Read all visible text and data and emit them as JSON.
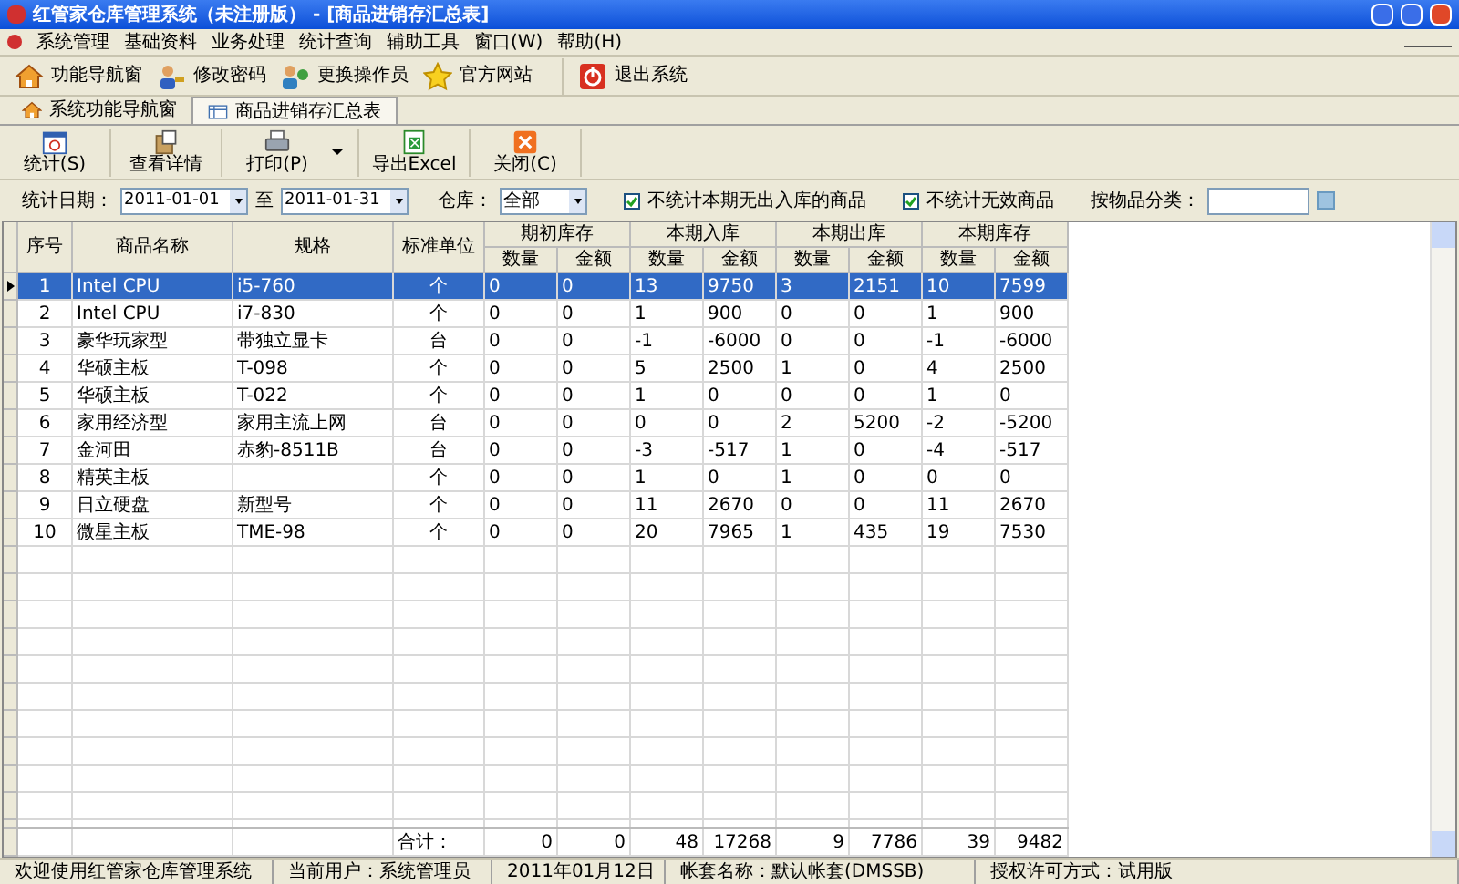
{
  "window": {
    "title": "红管家仓库管理系统（未注册版） - [商品进销存汇总表]"
  },
  "menu": [
    "系统管理",
    "基础资料",
    "业务处理",
    "统计查询",
    "辅助工具",
    "窗口(W)",
    "帮助(H)"
  ],
  "main_toolbar": [
    "功能导航窗",
    "修改密码",
    "更换操作员",
    "官方网站",
    "退出系统"
  ],
  "tabs": [
    {
      "label": "系统功能导航窗",
      "selected": false
    },
    {
      "label": "商品进销存汇总表",
      "selected": true
    }
  ],
  "report_toolbar": [
    "统计(S)",
    "查看详情",
    "打印(P)",
    "导出Excel",
    "关闭(C)"
  ],
  "filters": {
    "date_label": "统计日期：",
    "date_from": "2011-01-01",
    "date_sep": "至",
    "date_to": "2011-01-31",
    "warehouse_label": "仓库：",
    "warehouse": "全部",
    "checks": [
      {
        "label": "不统计本期无出入库的商品",
        "checked": true
      },
      {
        "label": "不统计无效商品",
        "checked": true
      }
    ],
    "category_label": "按物品分类："
  },
  "table": {
    "columns": [
      "序号",
      "商品名称",
      "规格",
      "标准单位"
    ],
    "groups": [
      {
        "label": "期初库存",
        "subs": [
          "数量",
          "金额"
        ]
      },
      {
        "label": "本期入库",
        "subs": [
          "数量",
          "金额"
        ]
      },
      {
        "label": "本期出库",
        "subs": [
          "数量",
          "金额"
        ]
      },
      {
        "label": "本期库存",
        "subs": [
          "数量",
          "金额"
        ]
      }
    ],
    "rows": [
      {
        "selected": true,
        "cells": [
          "1",
          "Intel CPU",
          "i5-760",
          "个"
        ],
        "values": [
          "0",
          "0",
          "13",
          "9750",
          "3",
          "2151",
          "10",
          "7599"
        ]
      },
      {
        "selected": false,
        "cells": [
          "2",
          "Intel CPU",
          "i7-830",
          "个"
        ],
        "values": [
          "0",
          "0",
          "1",
          "900",
          "0",
          "0",
          "1",
          "900"
        ]
      },
      {
        "selected": false,
        "cells": [
          "3",
          "豪华玩家型",
          "带独立显卡",
          "台"
        ],
        "values": [
          "0",
          "0",
          "-1",
          "-6000",
          "0",
          "0",
          "-1",
          "-6000"
        ]
      },
      {
        "selected": false,
        "cells": [
          "4",
          "华硕主板",
          "T-098",
          "个"
        ],
        "values": [
          "0",
          "0",
          "5",
          "2500",
          "1",
          "0",
          "4",
          "2500"
        ]
      },
      {
        "selected": false,
        "cells": [
          "5",
          "华硕主板",
          "T-022",
          "个"
        ],
        "values": [
          "0",
          "0",
          "1",
          "0",
          "0",
          "0",
          "1",
          "0"
        ]
      },
      {
        "selected": false,
        "cells": [
          "6",
          "家用经济型",
          "家用主流上网",
          "台"
        ],
        "values": [
          "0",
          "0",
          "0",
          "0",
          "2",
          "5200",
          "-2",
          "-5200"
        ]
      },
      {
        "selected": false,
        "cells": [
          "7",
          "金河田",
          "赤豹-8511B",
          "台"
        ],
        "values": [
          "0",
          "0",
          "-3",
          "-517",
          "1",
          "0",
          "-4",
          "-517"
        ]
      },
      {
        "selected": false,
        "cells": [
          "8",
          "精英主板",
          "",
          "个"
        ],
        "values": [
          "0",
          "0",
          "1",
          "0",
          "1",
          "0",
          "0",
          "0"
        ]
      },
      {
        "selected": false,
        "cells": [
          "9",
          "日立硬盘",
          "新型号",
          "个"
        ],
        "values": [
          "0",
          "0",
          "11",
          "2670",
          "0",
          "0",
          "11",
          "2670"
        ]
      },
      {
        "selected": false,
        "cells": [
          "10",
          "微星主板",
          "TME-98",
          "个"
        ],
        "values": [
          "0",
          "0",
          "20",
          "7965",
          "1",
          "435",
          "19",
          "7530"
        ]
      }
    ],
    "totals_label": "合计：",
    "totals": [
      "0",
      "0",
      "48",
      "17268",
      "9",
      "7786",
      "39",
      "9482"
    ]
  },
  "status_bar": [
    "欢迎使用红管家仓库管理系统",
    "当前用户：系统管理员",
    "2011年01月12日",
    "帐套名称：默认帐套(DMSSB)",
    "授权许可方式：试用版"
  ]
}
